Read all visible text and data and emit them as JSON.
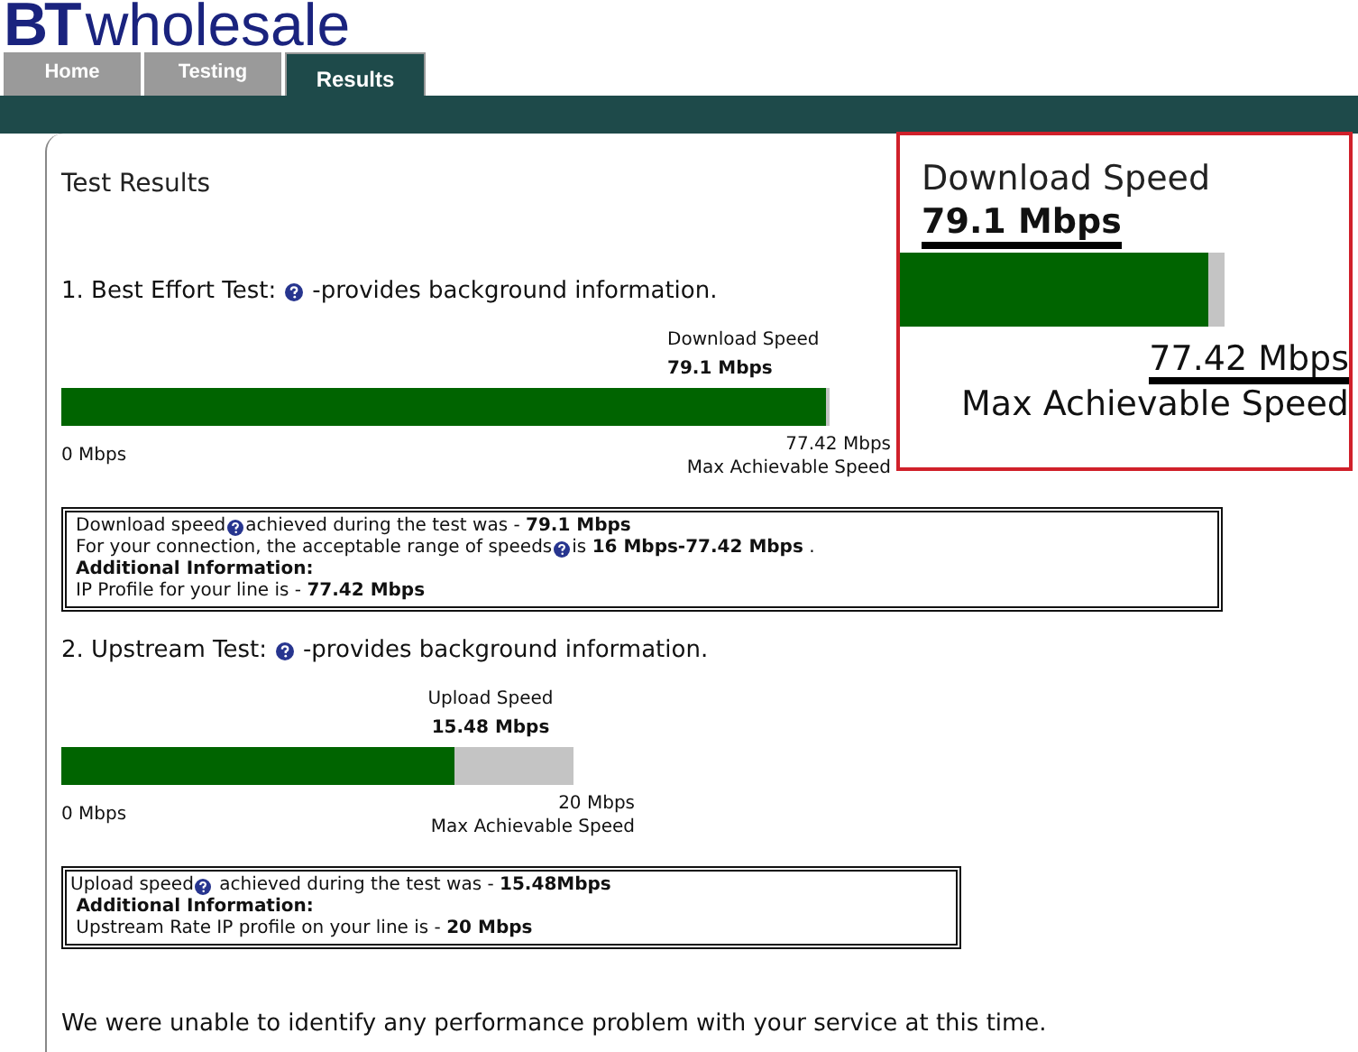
{
  "logo": {
    "mark": "BT",
    "name": "wholesale"
  },
  "tabs": [
    {
      "label": "Home",
      "selected": false
    },
    {
      "label": "Testing",
      "selected": false
    },
    {
      "label": "Results",
      "selected": true
    }
  ],
  "title": "Test Results",
  "tests": [
    {
      "heading": "1. Best Effort Test:",
      "help_text": "-provides background information.",
      "bar_title": "Download Speed",
      "bar_value": "79.1 Mbps",
      "level": 0.995,
      "min_label": "0 Mbps",
      "max_value": "77.42 Mbps",
      "max_label": "Max Achievable Speed",
      "wide": true,
      "info_lines": [
        [
          {
            "kind": "text",
            "text": "Download speed"
          },
          {
            "kind": "help"
          },
          {
            "kind": "text",
            "text": "achieved during the test was - **79.1 Mbps**"
          }
        ],
        [
          {
            "kind": "text",
            "text": "For your connection, the acceptable range of speeds"
          },
          {
            "kind": "help"
          },
          {
            "kind": "text",
            "text": "is **16 Mbps-77.42 Mbps** ."
          }
        ],
        [
          {
            "kind": "text",
            "text": "**Additional Information:**"
          }
        ],
        [
          {
            "kind": "text",
            "text": "IP Profile for your line is - **77.42 Mbps**"
          }
        ]
      ]
    },
    {
      "heading": "2. Upstream Test:",
      "help_text": "-provides background information.",
      "bar_title": "Upload Speed",
      "bar_value": "15.48 Mbps",
      "level": 0.768,
      "min_label": "0 Mbps",
      "max_value": "20 Mbps",
      "max_label": "Max Achievable Speed",
      "wide": false,
      "info_lines": [
        [
          {
            "kind": "text",
            "text": "Upload speed"
          },
          {
            "kind": "help"
          },
          {
            "kind": "text",
            "text": " achieved during the test was - **15.48Mbps**"
          }
        ],
        [
          {
            "kind": "text",
            "text": " **Additional Information:**"
          }
        ],
        [
          {
            "kind": "text",
            "text": " Upstream Rate IP profile on your line is - **20 Mbps**"
          }
        ]
      ]
    }
  ],
  "conclusion": "We were unable to identify any performance problem with your service at this time.",
  "zoom_callout": {
    "title": "Download Speed",
    "value": "79.1 Mbps",
    "level": 0.95,
    "max_value": "77.42 Mbps",
    "max_label": "Max Achievable Speed"
  }
}
